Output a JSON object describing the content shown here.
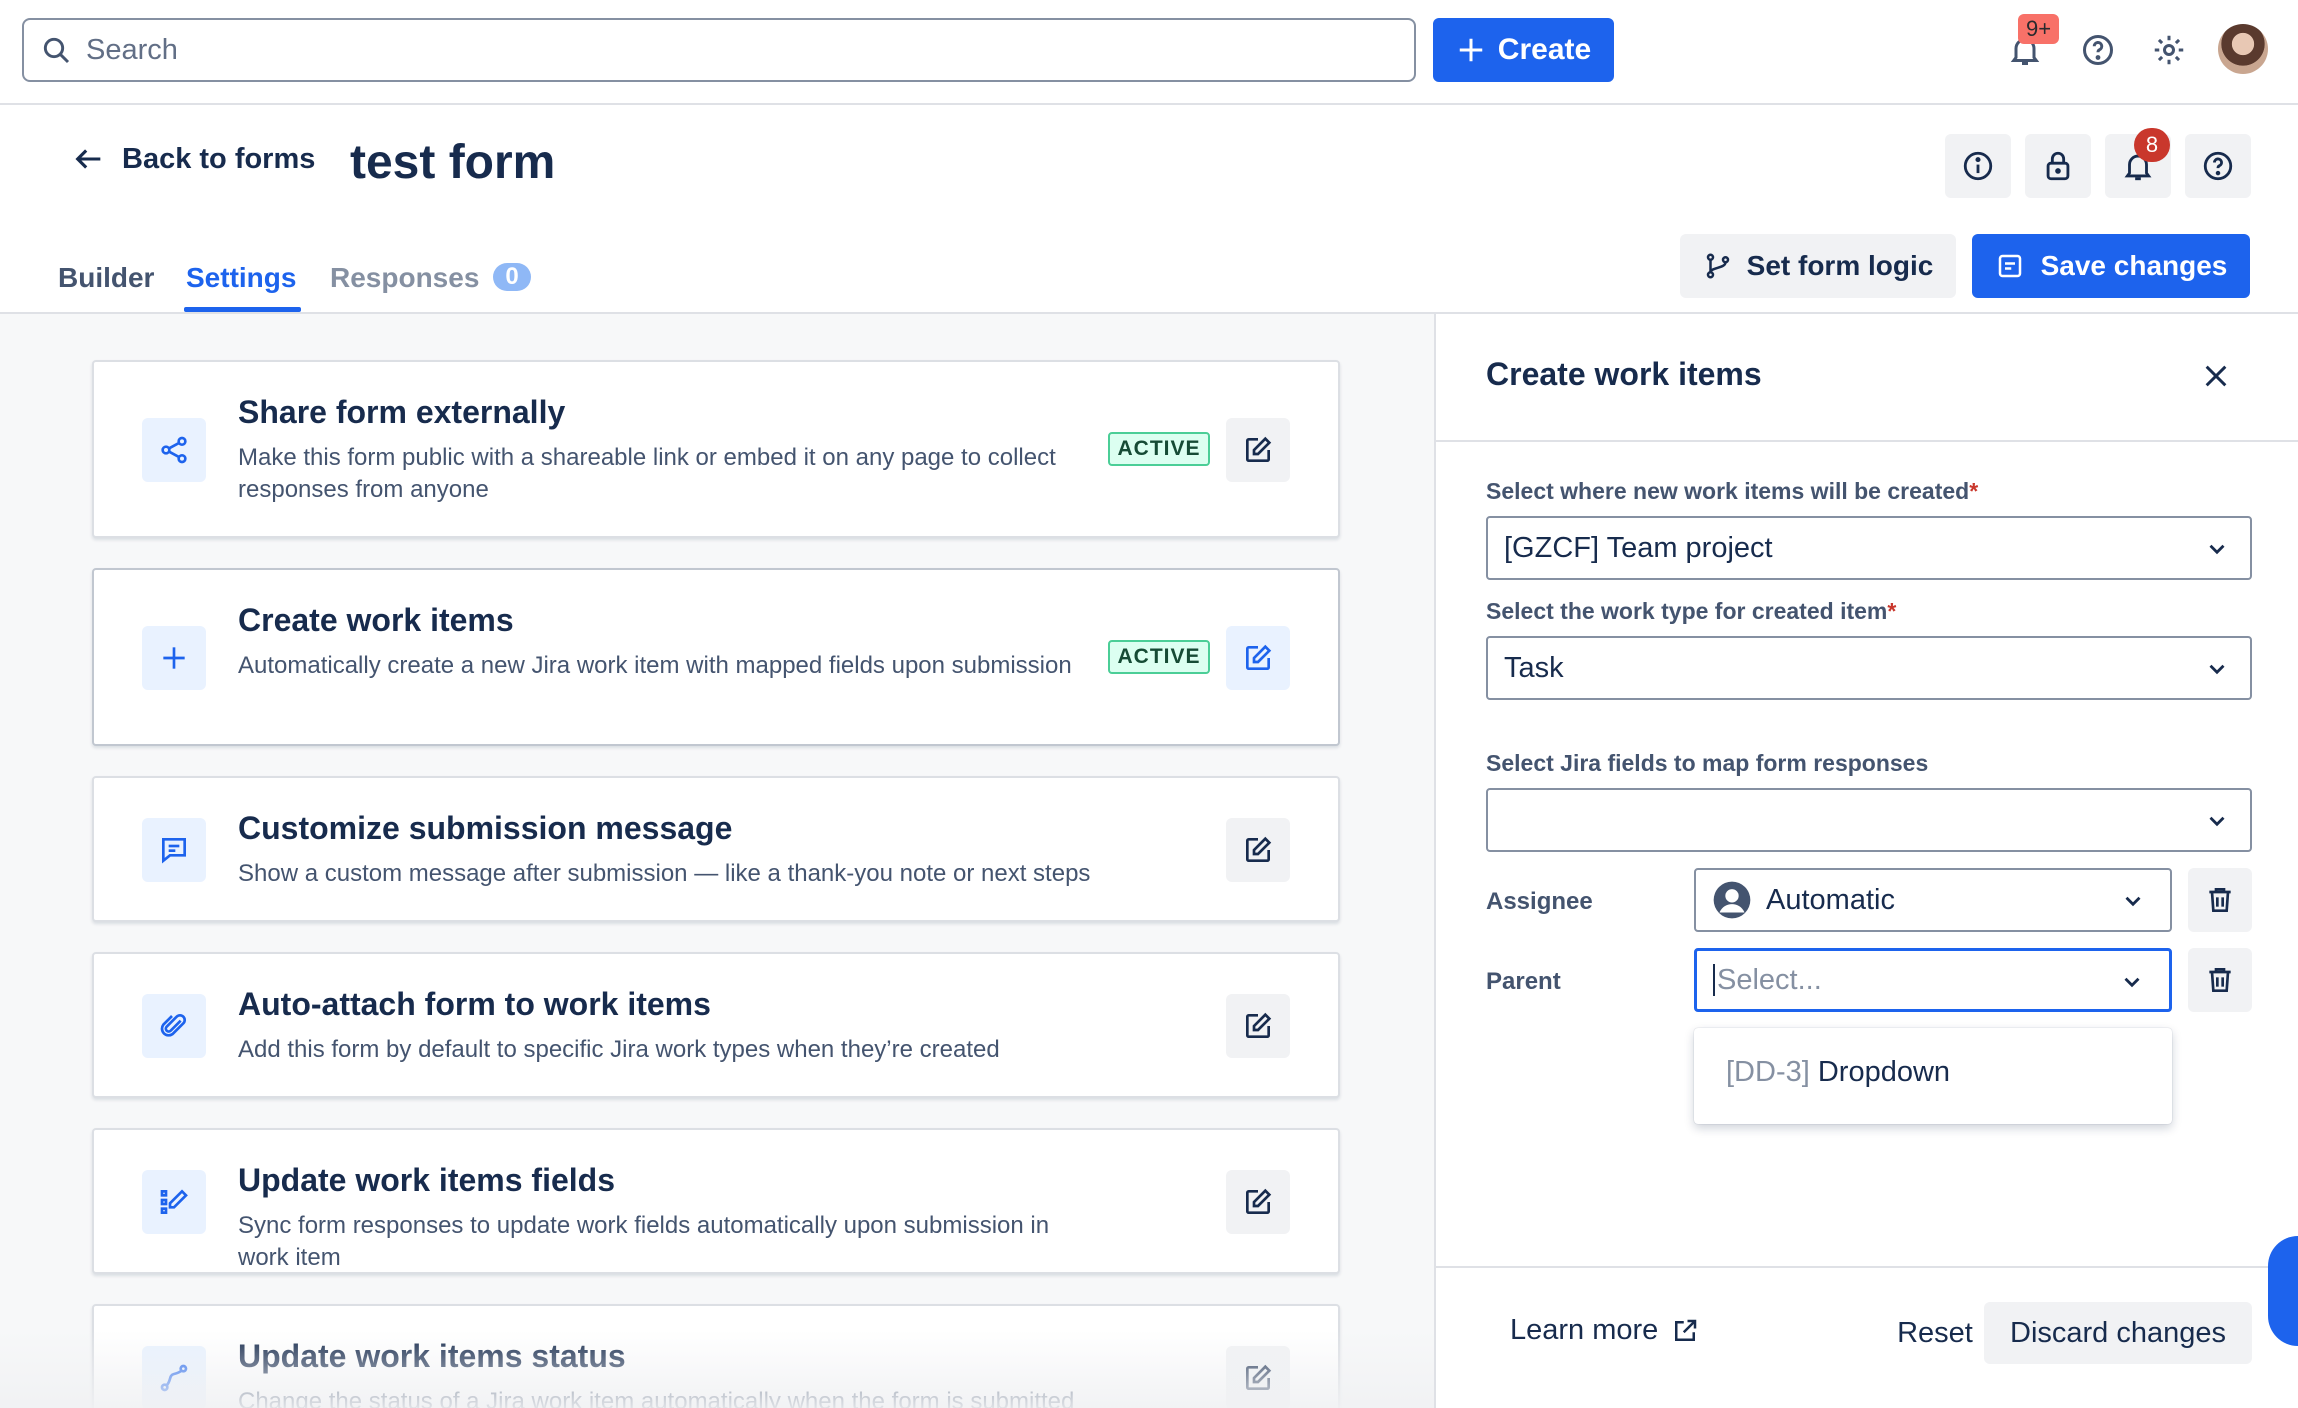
{
  "topbar": {
    "search_placeholder": "Search",
    "create_label": "Create",
    "notifications_badge": "9+"
  },
  "header": {
    "back_label": "Back to forms",
    "title": "test form",
    "alerts_badge": "8"
  },
  "tabs": {
    "builder": "Builder",
    "settings": "Settings",
    "responses": "Responses",
    "responses_count": "0"
  },
  "actions": {
    "set_form_logic": "Set form logic",
    "save_changes": "Save changes"
  },
  "settings_cards": [
    {
      "title": "Share form externally",
      "desc": "Make this form public with a shareable link or embed it on any page to collect responses from anyone",
      "status": "ACTIVE"
    },
    {
      "title": "Create work items",
      "desc": "Automatically create a new Jira work item with mapped fields upon submission",
      "status": "ACTIVE"
    },
    {
      "title": "Customize submission message",
      "desc": "Show a custom message after submission — like a thank-you note or next steps"
    },
    {
      "title": "Auto-attach form to work items",
      "desc": "Add this form by default to specific Jira work types when they’re created"
    },
    {
      "title": "Update work items fields",
      "desc": "Sync form responses to update work fields automatically upon submission in work item"
    },
    {
      "title": "Update work items status",
      "desc": "Change the status of a Jira work item automatically when the form is submitted"
    }
  ],
  "panel": {
    "title": "Create work items",
    "location_label": "Select where new work items will be created",
    "location_value": "[GZCF] Team project",
    "work_type_label": "Select the work type for created item",
    "work_type_value": "Task",
    "jira_fields_label": "Select Jira fields to map form responses",
    "assignee_label": "Assignee",
    "assignee_value": "Automatic",
    "parent_label": "Parent",
    "parent_placeholder": "Select...",
    "dropdown_option_key": "[DD-3]",
    "dropdown_option_label": "Dropdown",
    "learn_more": "Learn more",
    "reset": "Reset",
    "discard": "Discard changes",
    "required_mark": "*"
  },
  "colors": {
    "primary": "#1d63ed",
    "active_badge_bg": "#dcfff1",
    "active_badge_border": "#4bce97",
    "danger": "#c9372c"
  }
}
